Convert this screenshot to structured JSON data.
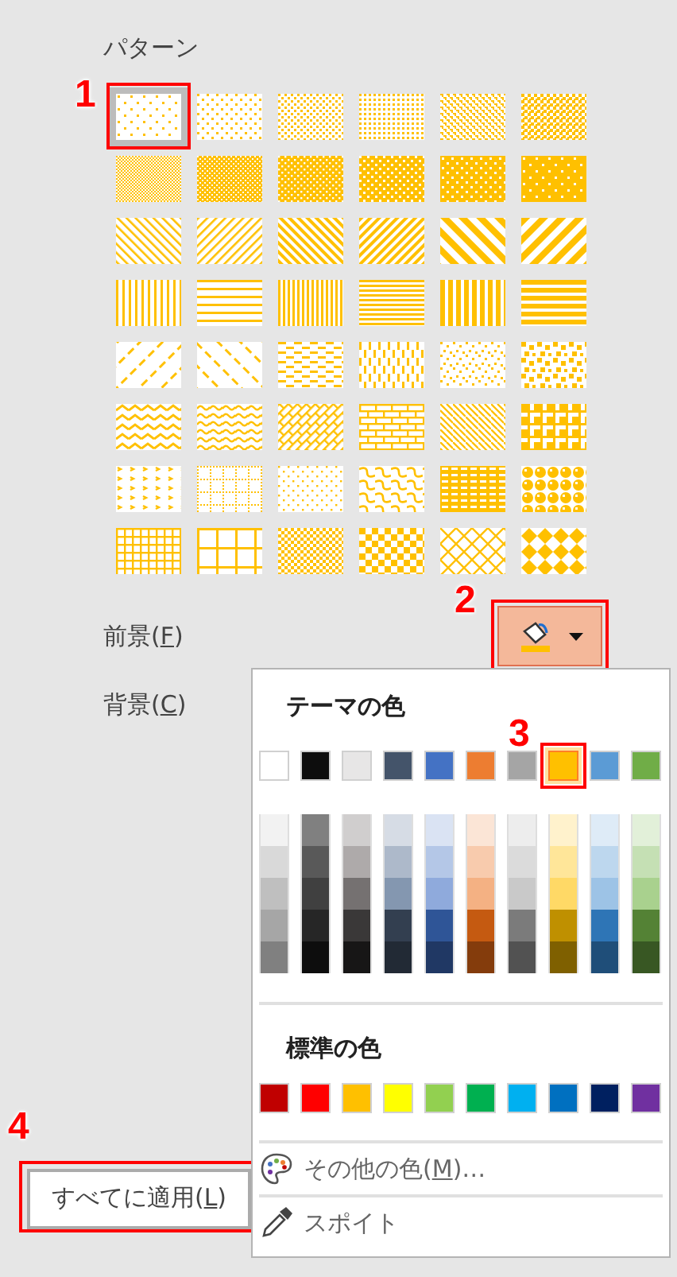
{
  "pattern_section": {
    "title": "パターン",
    "patterns": [
      {
        "kind": "pct5",
        "selected": true,
        "step": "1"
      },
      {
        "kind": "pct10",
        "selected": false
      },
      {
        "kind": "pct20",
        "selected": false
      },
      {
        "kind": "pct25",
        "selected": false
      },
      {
        "kind": "pct30",
        "selected": false
      },
      {
        "kind": "pct40",
        "selected": false
      },
      {
        "kind": "pct50",
        "selected": false
      },
      {
        "kind": "pct60",
        "selected": false
      },
      {
        "kind": "pct70",
        "selected": false
      },
      {
        "kind": "pct75",
        "selected": false
      },
      {
        "kind": "pct80",
        "selected": false
      },
      {
        "kind": "pct90",
        "selected": false
      },
      {
        "kind": "ltDnDiag",
        "selected": false
      },
      {
        "kind": "ltUpDiag",
        "selected": false
      },
      {
        "kind": "dkDnDiag",
        "selected": false
      },
      {
        "kind": "dkUpDiag",
        "selected": false
      },
      {
        "kind": "wdDnDiag",
        "selected": false
      },
      {
        "kind": "wdUpDiag",
        "selected": false
      },
      {
        "kind": "ltVert",
        "selected": false
      },
      {
        "kind": "ltHorz",
        "selected": false
      },
      {
        "kind": "narVert",
        "selected": false
      },
      {
        "kind": "narHorz",
        "selected": false
      },
      {
        "kind": "dkVert",
        "selected": false
      },
      {
        "kind": "dkHorz",
        "selected": false
      },
      {
        "kind": "dashDnDiag",
        "selected": false
      },
      {
        "kind": "dashUpDiag",
        "selected": false
      },
      {
        "kind": "dashHorz",
        "selected": false
      },
      {
        "kind": "dashVert",
        "selected": false
      },
      {
        "kind": "smConfetti",
        "selected": false
      },
      {
        "kind": "lgConfetti",
        "selected": false
      },
      {
        "kind": "zigZag",
        "selected": false
      },
      {
        "kind": "wave",
        "selected": false
      },
      {
        "kind": "diagBrick",
        "selected": false
      },
      {
        "kind": "horzBrick",
        "selected": false
      },
      {
        "kind": "weave",
        "selected": false
      },
      {
        "kind": "plaid",
        "selected": false
      },
      {
        "kind": "divot",
        "selected": false
      },
      {
        "kind": "dotGrid",
        "selected": false
      },
      {
        "kind": "dotDmnd",
        "selected": false
      },
      {
        "kind": "shingle",
        "selected": false
      },
      {
        "kind": "trellis",
        "selected": false
      },
      {
        "kind": "sphere",
        "selected": false
      },
      {
        "kind": "smGrid",
        "selected": false
      },
      {
        "kind": "lgGrid",
        "selected": false
      },
      {
        "kind": "smCheck",
        "selected": false
      },
      {
        "kind": "lgCheck",
        "selected": false
      },
      {
        "kind": "openDmnd",
        "selected": false
      },
      {
        "kind": "solidDmnd",
        "selected": false
      }
    ]
  },
  "foreground": {
    "before": "前景(",
    "mnemonic": "F",
    "after": ")",
    "step": "2"
  },
  "background": {
    "before": "背景(",
    "mnemonic": "C",
    "after": ")"
  },
  "color_menu": {
    "theme_title": "テーマの色",
    "theme_colors": [
      {
        "color": "#ffffff",
        "selected": false,
        "shades": [
          {
            "color": "#f2f2f2"
          },
          {
            "color": "#d9d9d9"
          },
          {
            "color": "#bfbfbf"
          },
          {
            "color": "#a6a6a6"
          },
          {
            "color": "#808080"
          }
        ]
      },
      {
        "color": "#0d0d0d",
        "selected": false,
        "shades": [
          {
            "color": "#808080"
          },
          {
            "color": "#595959"
          },
          {
            "color": "#404040"
          },
          {
            "color": "#262626"
          },
          {
            "color": "#0d0d0d"
          }
        ]
      },
      {
        "color": "#e7e6e6",
        "selected": false,
        "shades": [
          {
            "color": "#d0cece"
          },
          {
            "color": "#aeaaaa"
          },
          {
            "color": "#757171"
          },
          {
            "color": "#3a3838"
          },
          {
            "color": "#171616"
          }
        ]
      },
      {
        "color": "#44546a",
        "selected": false,
        "shades": [
          {
            "color": "#d6dce5"
          },
          {
            "color": "#adb9ca"
          },
          {
            "color": "#8497b0"
          },
          {
            "color": "#333f50"
          },
          {
            "color": "#222a35"
          }
        ]
      },
      {
        "color": "#4472c4",
        "selected": false,
        "shades": [
          {
            "color": "#dae3f3"
          },
          {
            "color": "#b4c7e7"
          },
          {
            "color": "#8faadc"
          },
          {
            "color": "#2f5597"
          },
          {
            "color": "#203864"
          }
        ]
      },
      {
        "color": "#ed7d31",
        "selected": false,
        "shades": [
          {
            "color": "#fbe5d6"
          },
          {
            "color": "#f8cbad"
          },
          {
            "color": "#f4b183"
          },
          {
            "color": "#c55a11"
          },
          {
            "color": "#843c0c"
          }
        ]
      },
      {
        "color": "#a5a5a5",
        "selected": false,
        "shades": [
          {
            "color": "#ededed"
          },
          {
            "color": "#dbdbdb"
          },
          {
            "color": "#c9c9c9"
          },
          {
            "color": "#7b7b7b"
          },
          {
            "color": "#525252"
          }
        ]
      },
      {
        "color": "#ffc000",
        "selected": true,
        "step": "3",
        "shades": [
          {
            "color": "#fff2cc"
          },
          {
            "color": "#ffe699"
          },
          {
            "color": "#ffd966"
          },
          {
            "color": "#bf9000"
          },
          {
            "color": "#7f6000"
          }
        ]
      },
      {
        "color": "#5b9bd5",
        "selected": false,
        "shades": [
          {
            "color": "#deebf7"
          },
          {
            "color": "#bdd7ee"
          },
          {
            "color": "#9dc3e6"
          },
          {
            "color": "#2e75b6"
          },
          {
            "color": "#1f4e79"
          }
        ]
      },
      {
        "color": "#70ad47",
        "selected": false,
        "shades": [
          {
            "color": "#e2f0d9"
          },
          {
            "color": "#c5e0b4"
          },
          {
            "color": "#a9d18e"
          },
          {
            "color": "#548235"
          },
          {
            "color": "#385723"
          }
        ]
      }
    ],
    "standard_title": "標準の色",
    "standard_colors": [
      {
        "color": "#c00000"
      },
      {
        "color": "#ff0000"
      },
      {
        "color": "#ffc000"
      },
      {
        "color": "#ffff00"
      },
      {
        "color": "#92d050"
      },
      {
        "color": "#00b050"
      },
      {
        "color": "#00b0f0"
      },
      {
        "color": "#0070c0"
      },
      {
        "color": "#002060"
      },
      {
        "color": "#7030a0"
      }
    ],
    "items": [
      {
        "kind": "more_colors",
        "before": "その他の色(",
        "mnemonic": "M",
        "after": ")…"
      },
      {
        "kind": "eyedropper",
        "before": "スポイト"
      }
    ]
  },
  "apply_button": {
    "before": "すべてに適用(",
    "mnemonic": "L",
    "after": ")",
    "step": "4"
  }
}
